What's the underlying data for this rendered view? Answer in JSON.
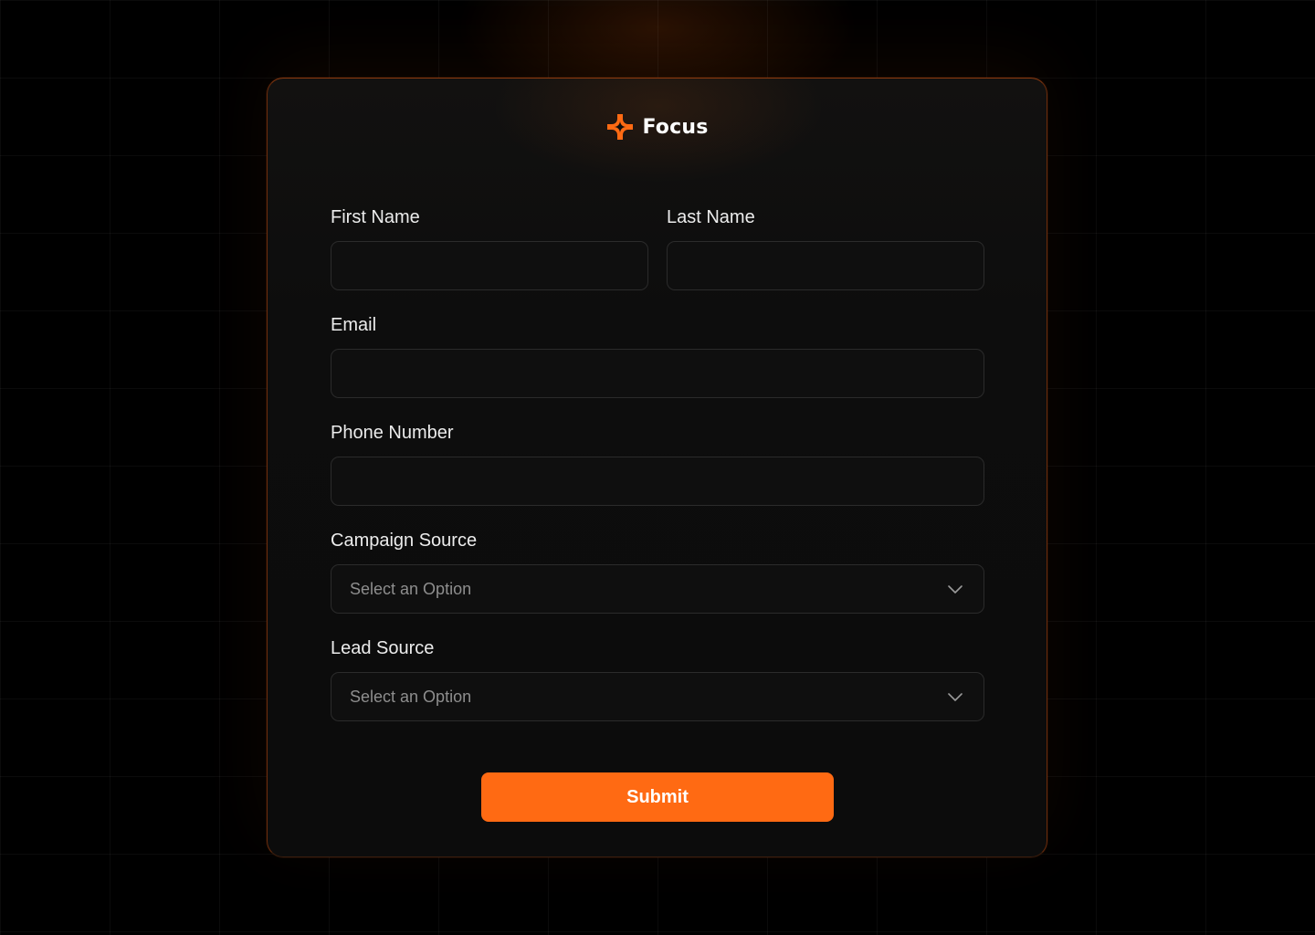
{
  "brand": {
    "name": "Focus",
    "logo_icon": "four-point-star-icon",
    "accent_color": "#ff6a13"
  },
  "form": {
    "first_name": {
      "label": "First Name",
      "value": "",
      "placeholder": ""
    },
    "last_name": {
      "label": "Last Name",
      "value": "",
      "placeholder": ""
    },
    "email": {
      "label": "Email",
      "value": "",
      "placeholder": ""
    },
    "phone": {
      "label": "Phone Number",
      "value": "",
      "placeholder": ""
    },
    "campaign_source": {
      "label": "Campaign Source",
      "selected": "Select an Option",
      "icon": "chevron-down-icon"
    },
    "lead_source": {
      "label": "Lead Source",
      "selected": "Select an Option",
      "icon": "chevron-down-icon"
    },
    "submit_label": "Submit"
  }
}
